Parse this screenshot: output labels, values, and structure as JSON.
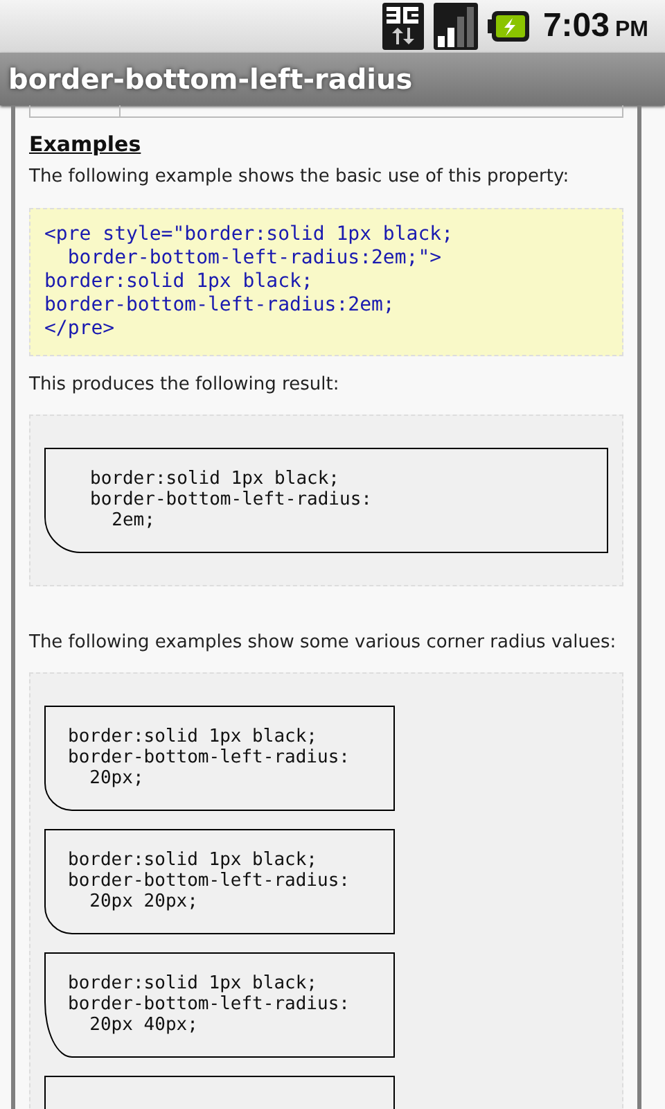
{
  "status_bar": {
    "time": "7:03",
    "meridiem": "PM"
  },
  "title_bar": {
    "title": "border-bottom-left-radius"
  },
  "content": {
    "heading": "Examples",
    "intro": "The following example shows the basic use of this property:",
    "source_code": "<pre style=\"border:solid 1px black;\n  border-bottom-left-radius:2em;\">\nborder:solid 1px black;\nborder-bottom-left-radius:2em;\n</pre>",
    "result_intro": "This produces the following result:",
    "result_code": "border:solid 1px black;\nborder-bottom-left-radius:\n  2em;",
    "more_intro": "The following examples show some various corner radius values:",
    "examples": [
      {
        "code": "border:solid 1px black;\nborder-bottom-left-radius:\n  20px;"
      },
      {
        "code": "border:solid 1px black;\nborder-bottom-left-radius:\n  20px 20px;"
      },
      {
        "code": "border:solid 1px black;\nborder-bottom-left-radius:\n  20px 40px;"
      }
    ]
  }
}
